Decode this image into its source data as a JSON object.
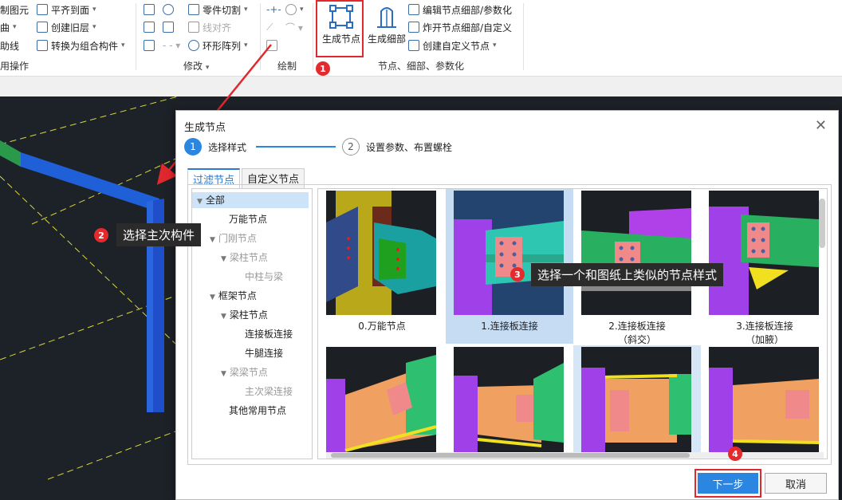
{
  "ribbon": {
    "col1": [
      "制图元",
      "曲",
      "助线"
    ],
    "col2": [
      "平齐到面",
      "创建旧层",
      "转换为组合构件"
    ],
    "edit_items": [
      "零件切割",
      "线对齐",
      "环形阵列"
    ],
    "groups": {
      "g1": "用操作",
      "modify": "修改",
      "draw": "绘制",
      "node": "节点、细部、参数化"
    },
    "big_btn_1": "生成节点",
    "big_btn_2": "生成细部",
    "node_items": [
      "编辑节点细部/参数化",
      "炸开节点细部/自定义",
      "创建自定义节点"
    ]
  },
  "badges": [
    "1",
    "2",
    "3",
    "4"
  ],
  "tooltips": {
    "t2": "选择主次构件",
    "t3": "选择一个和图纸上类似的节点样式"
  },
  "dialog": {
    "title": "生成节点",
    "close": "✕",
    "step1_num": "1",
    "step1": "选择样式",
    "step2_num": "2",
    "step2": "设置参数、布置螺栓",
    "tabs": [
      "过滤节点",
      "自定义节点"
    ],
    "tree": [
      {
        "label": "全部",
        "level": 0,
        "arrow": "▼",
        "selected": true
      },
      {
        "label": "万能节点",
        "level": 1,
        "arrow": ""
      },
      {
        "label": "门刚节点",
        "level": 1,
        "arrow": "▼",
        "dim": true
      },
      {
        "label": "梁柱节点",
        "level": 2,
        "arrow": "▼",
        "dim": true
      },
      {
        "label": "中柱与梁",
        "level": 3,
        "arrow": "",
        "dim": true
      },
      {
        "label": "框架节点",
        "level": 1,
        "arrow": "▼"
      },
      {
        "label": "梁柱节点",
        "level": 2,
        "arrow": "▼"
      },
      {
        "label": "连接板连接",
        "level": 3,
        "arrow": ""
      },
      {
        "label": "牛腿连接",
        "level": 3,
        "arrow": ""
      },
      {
        "label": "梁梁节点",
        "level": 2,
        "arrow": "▼",
        "dim": true
      },
      {
        "label": "主次梁连接",
        "level": 3,
        "arrow": "",
        "dim": true
      },
      {
        "label": "其他常用节点",
        "level": 1,
        "arrow": ""
      }
    ],
    "nodes": [
      {
        "caption": "0.万能节点",
        "selected": false
      },
      {
        "caption": "1.连接板连接",
        "selected": true
      },
      {
        "caption": "2.连接板连接\n（斜交）",
        "selected": false
      },
      {
        "caption": "3.连接板连接\n（加腋）",
        "selected": false
      }
    ],
    "next": "下一步",
    "cancel": "取消"
  },
  "colors": {
    "accent": "#2a86e0",
    "highlight": "#e0282e",
    "canvas": "#1d2128"
  }
}
